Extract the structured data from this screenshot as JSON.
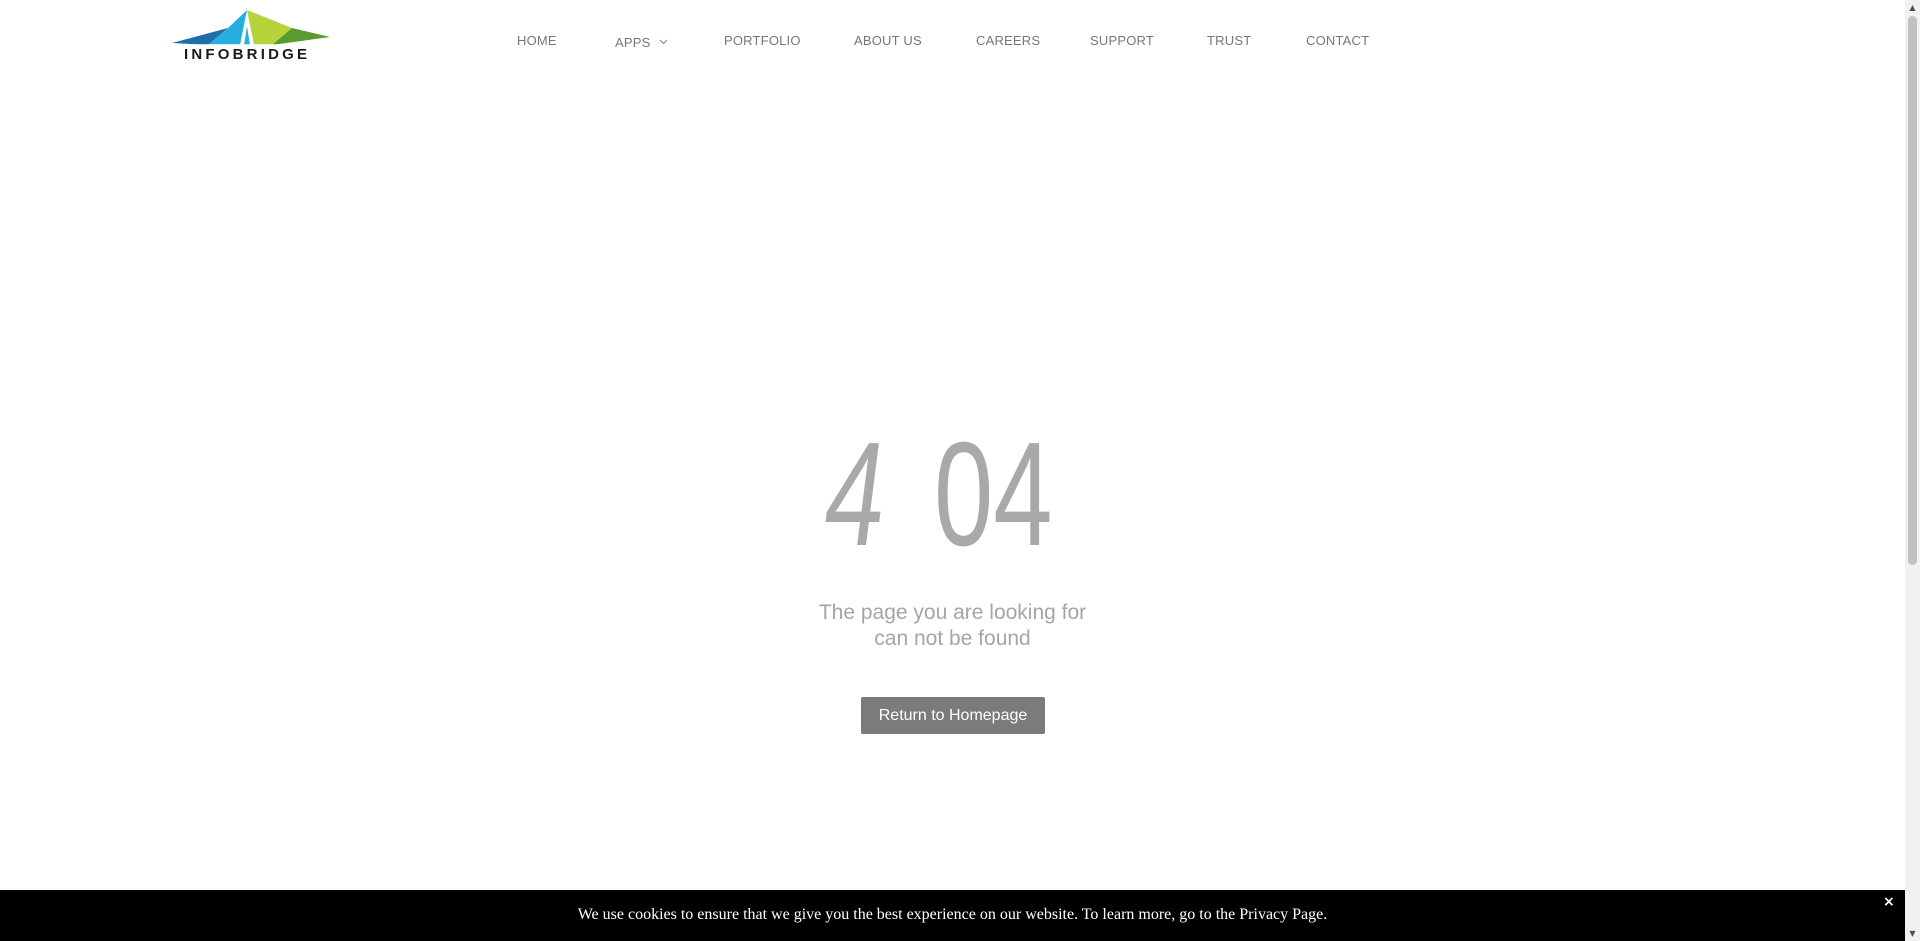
{
  "brand": {
    "logo_text": "INFOBRIDGE",
    "colors": {
      "blue_dark": "#1c6fa8",
      "blue_light": "#27aee0",
      "green_light": "#b6d43a",
      "green_dark": "#5a9a2e"
    }
  },
  "nav": {
    "items": [
      {
        "label": "HOME"
      },
      {
        "label": "APPS",
        "has_dropdown": true,
        "icon": "chevron-down-icon"
      },
      {
        "label": "PORTFOLIO"
      },
      {
        "label": "ABOUT US"
      },
      {
        "label": "CAREERS"
      },
      {
        "label": "SUPPORT"
      },
      {
        "label": "TRUST"
      },
      {
        "label": "CONTACT"
      }
    ]
  },
  "error": {
    "digit_1": "4",
    "digits_rest": "04",
    "message_line1": "The page you are looking for",
    "message_line2": "can not be found",
    "button_label": "Return to Homepage"
  },
  "cookie": {
    "text": "We use cookies to ensure that we give you the best experience on our website. To learn more, go to the Privacy Page.",
    "close_label": "×"
  },
  "scrollbar": {
    "up_label": "▲",
    "down_label": "▼"
  }
}
